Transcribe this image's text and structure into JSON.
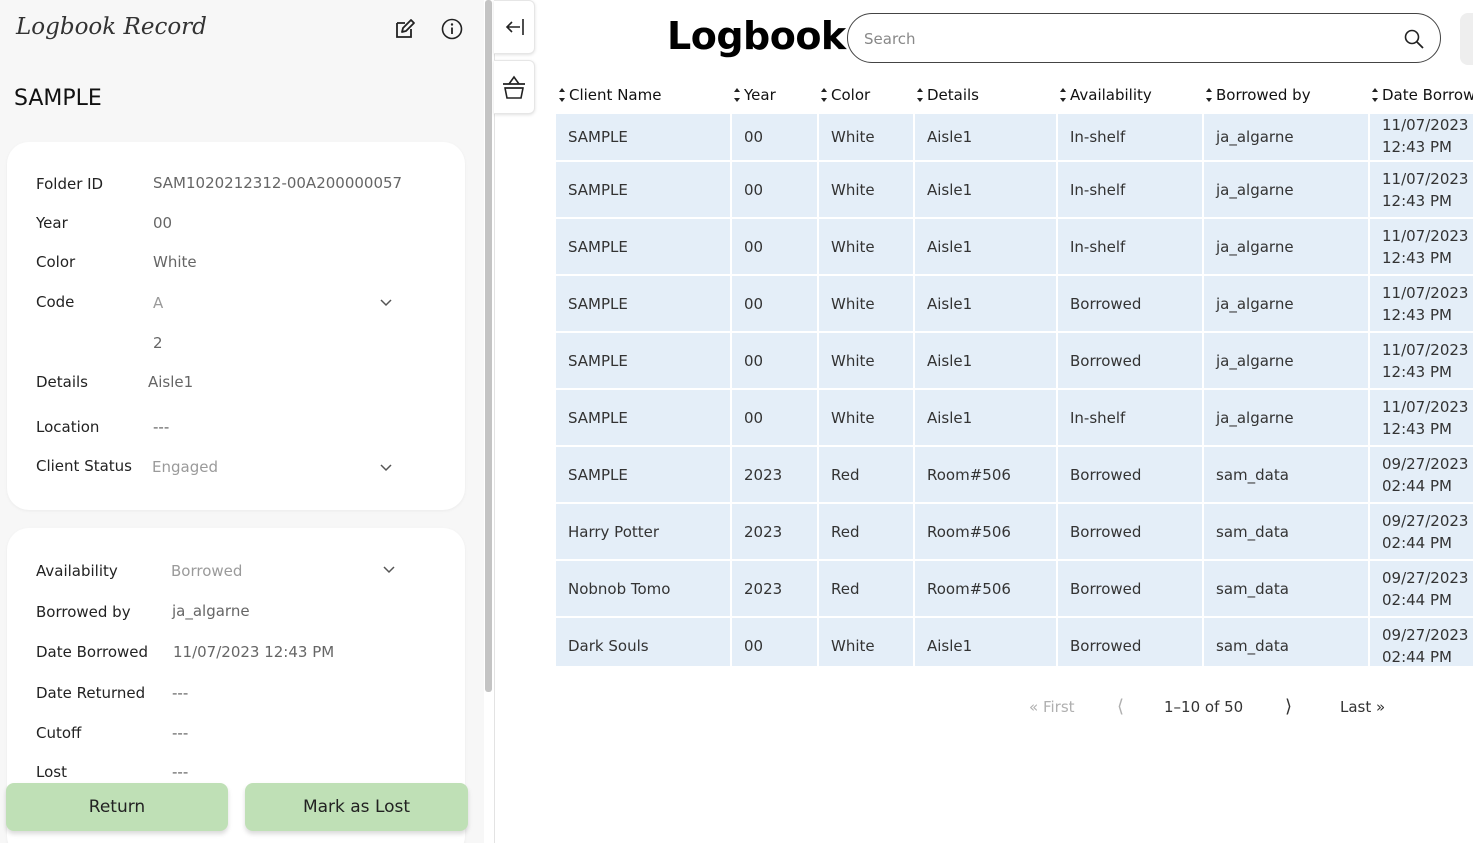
{
  "record_panel": {
    "title": "Logbook Record",
    "record_name": "SAMPLE",
    "info": {
      "folder_id_label": "Folder ID",
      "folder_id": "SAM1020212312-00A200000057",
      "year_label": "Year",
      "year": "00",
      "color_label": "Color",
      "color": "White",
      "code_label": "Code",
      "code": "A",
      "code_number": "2",
      "details_label": "Details",
      "details": "Aisle1",
      "location_label": "Location",
      "location": "---",
      "client_status_label": "Client Status",
      "client_status": "Engaged"
    },
    "borrow": {
      "availability_label": "Availability",
      "availability": "Borrowed",
      "borrowed_by_label": "Borrowed by",
      "borrowed_by": "ja_algarne",
      "date_borrowed_label": "Date Borrowed",
      "date_borrowed": "11/07/2023 12:43 PM",
      "date_returned_label": "Date Returned",
      "date_returned": "---",
      "cutoff_label": "Cutoff",
      "cutoff": "---",
      "lost_label": "Lost",
      "lost": "---"
    },
    "return_label": "Return",
    "mark_lost_label": "Mark as Lost"
  },
  "header": {
    "title": "Logbook",
    "search_placeholder": "Search"
  },
  "table": {
    "columns": [
      "Client Name",
      "Year",
      "Color",
      "Details",
      "Availability",
      "Borrowed by",
      "Date Borrowed"
    ],
    "rows": [
      {
        "client": "SAMPLE",
        "year": "00",
        "color": "White",
        "details": "Aisle1",
        "availability": "In-shelf",
        "borrowed_by": "ja_algarne",
        "date": "11/07/2023",
        "time": "12:43 PM"
      },
      {
        "client": "SAMPLE",
        "year": "00",
        "color": "White",
        "details": "Aisle1",
        "availability": "In-shelf",
        "borrowed_by": "ja_algarne",
        "date": "11/07/2023",
        "time": "12:43 PM"
      },
      {
        "client": "SAMPLE",
        "year": "00",
        "color": "White",
        "details": "Aisle1",
        "availability": "In-shelf",
        "borrowed_by": "ja_algarne",
        "date": "11/07/2023",
        "time": "12:43 PM"
      },
      {
        "client": "SAMPLE",
        "year": "00",
        "color": "White",
        "details": "Aisle1",
        "availability": "Borrowed",
        "borrowed_by": "ja_algarne",
        "date": "11/07/2023",
        "time": "12:43 PM"
      },
      {
        "client": "SAMPLE",
        "year": "00",
        "color": "White",
        "details": "Aisle1",
        "availability": "Borrowed",
        "borrowed_by": "ja_algarne",
        "date": "11/07/2023",
        "time": "12:43 PM"
      },
      {
        "client": "SAMPLE",
        "year": "00",
        "color": "White",
        "details": "Aisle1",
        "availability": "In-shelf",
        "borrowed_by": "ja_algarne",
        "date": "11/07/2023",
        "time": "12:43 PM"
      },
      {
        "client": "SAMPLE",
        "year": "2023",
        "color": "Red",
        "details": "Room#506",
        "availability": "Borrowed",
        "borrowed_by": "sam_data",
        "date": "09/27/2023",
        "time": "02:44 PM"
      },
      {
        "client": "Harry Potter",
        "year": "2023",
        "color": "Red",
        "details": "Room#506",
        "availability": "Borrowed",
        "borrowed_by": "sam_data",
        "date": "09/27/2023",
        "time": "02:44 PM"
      },
      {
        "client": "Nobnob Tomo",
        "year": "2023",
        "color": "Red",
        "details": "Room#506",
        "availability": "Borrowed",
        "borrowed_by": "sam_data",
        "date": "09/27/2023",
        "time": "02:44 PM"
      },
      {
        "client": "Dark Souls",
        "year": "00",
        "color": "White",
        "details": "Aisle1",
        "availability": "Borrowed",
        "borrowed_by": "sam_data",
        "date": "09/27/2023",
        "time": "02:44 PM"
      }
    ]
  },
  "pagination": {
    "first": "« First",
    "prev": "⟨",
    "info": "1–10  of  50",
    "next": "⟩",
    "last": "Last »"
  },
  "icons": {
    "edit": "edit-icon",
    "info": "info-icon",
    "collapse": "collapse-left-icon",
    "basket": "basket-icon",
    "search": "search-icon",
    "dropdown": "chevron-down-icon",
    "sort": "sort-icon"
  },
  "colors": {
    "row_background": "#e4eef8",
    "button_green": "#bfe0b6",
    "panel_background": "#f7f7f7"
  }
}
